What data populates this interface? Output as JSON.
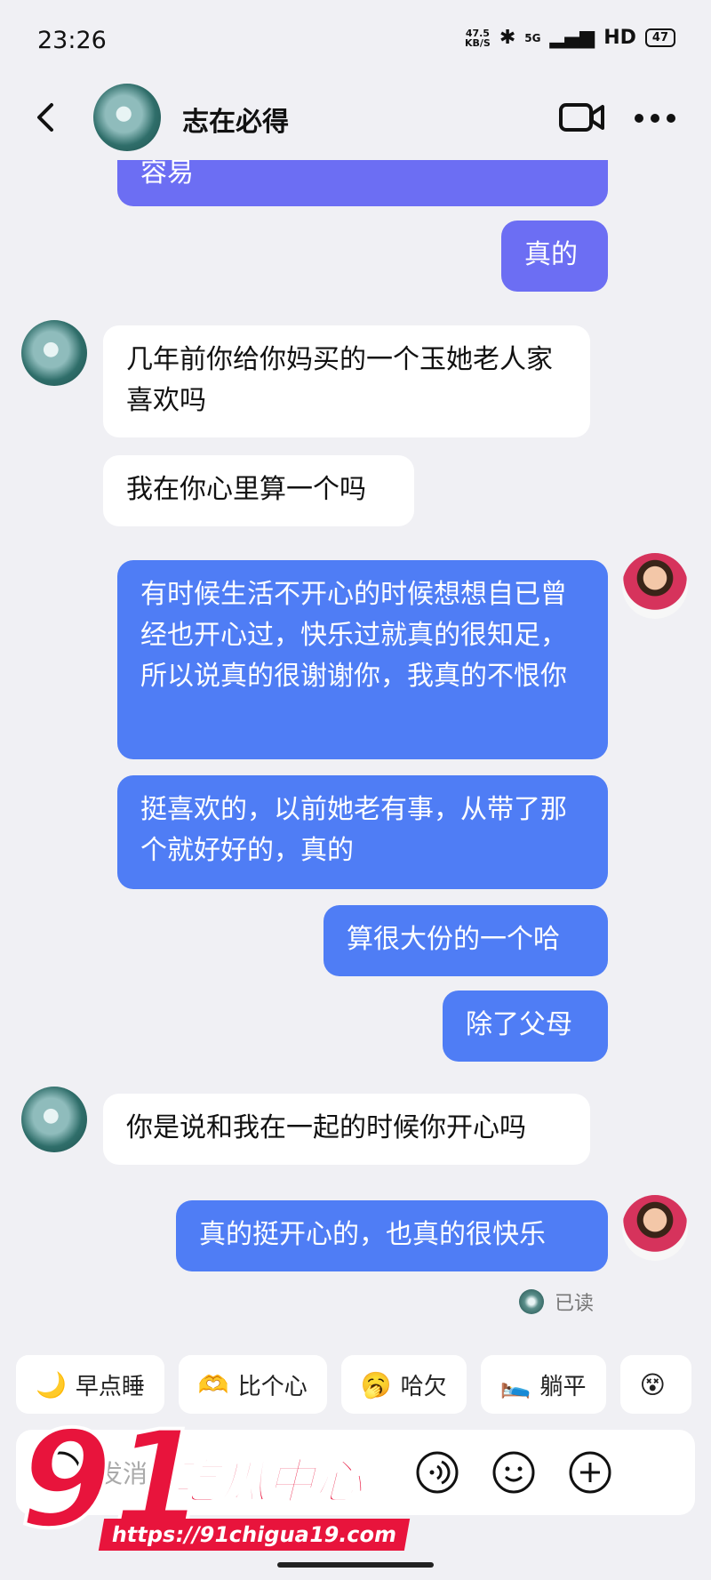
{
  "status_bar": {
    "time": "23:26",
    "net_speed_value": "47.5",
    "net_speed_unit": "KB/S",
    "network": "5G",
    "hd": "HD",
    "battery": "47"
  },
  "header": {
    "contact_name": "志在必得"
  },
  "messages": [
    {
      "from": "me",
      "text": "容易"
    },
    {
      "from": "me",
      "text": "真的"
    },
    {
      "from": "peer",
      "text": "几年前你给你妈买的一个玉她老人家喜欢吗"
    },
    {
      "from": "peer",
      "text": "我在你心里算一个吗"
    },
    {
      "from": "me",
      "text": "有时候生活不开心的时候想想自已曾经也开心过，快乐过就真的很知足，所以说真的很谢谢你，我真的不恨你"
    },
    {
      "from": "me",
      "text": "挺喜欢的，以前她老有事，从带了那个就好好的，真的"
    },
    {
      "from": "me",
      "text": "算很大份的一个哈"
    },
    {
      "from": "me",
      "text": "除了父母"
    },
    {
      "from": "peer",
      "text": "你是说和我在一起的时候你开心吗"
    },
    {
      "from": "me",
      "text": "真的挺开心的，也真的很快乐"
    }
  ],
  "read_status": "已读",
  "quick_replies": [
    {
      "icon": "🌙",
      "label": "早点睡"
    },
    {
      "icon": "🫶",
      "label": "比个心"
    },
    {
      "icon": "🥱",
      "label": "哈欠"
    },
    {
      "icon": "🛌",
      "label": "躺平"
    },
    {
      "icon": "😵",
      "label": ""
    }
  ],
  "input": {
    "placeholder": "发消息"
  },
  "watermark": {
    "number": "91",
    "text": "吃瓜中心",
    "url": "https://91chigua19.com"
  },
  "colors": {
    "outgoing_bubble": "#4f7df5",
    "outgoing_bubble_top": "#6c6ef3",
    "incoming_bubble": "#ffffff",
    "background": "#f0f0f4",
    "watermark": "#e8143c"
  }
}
